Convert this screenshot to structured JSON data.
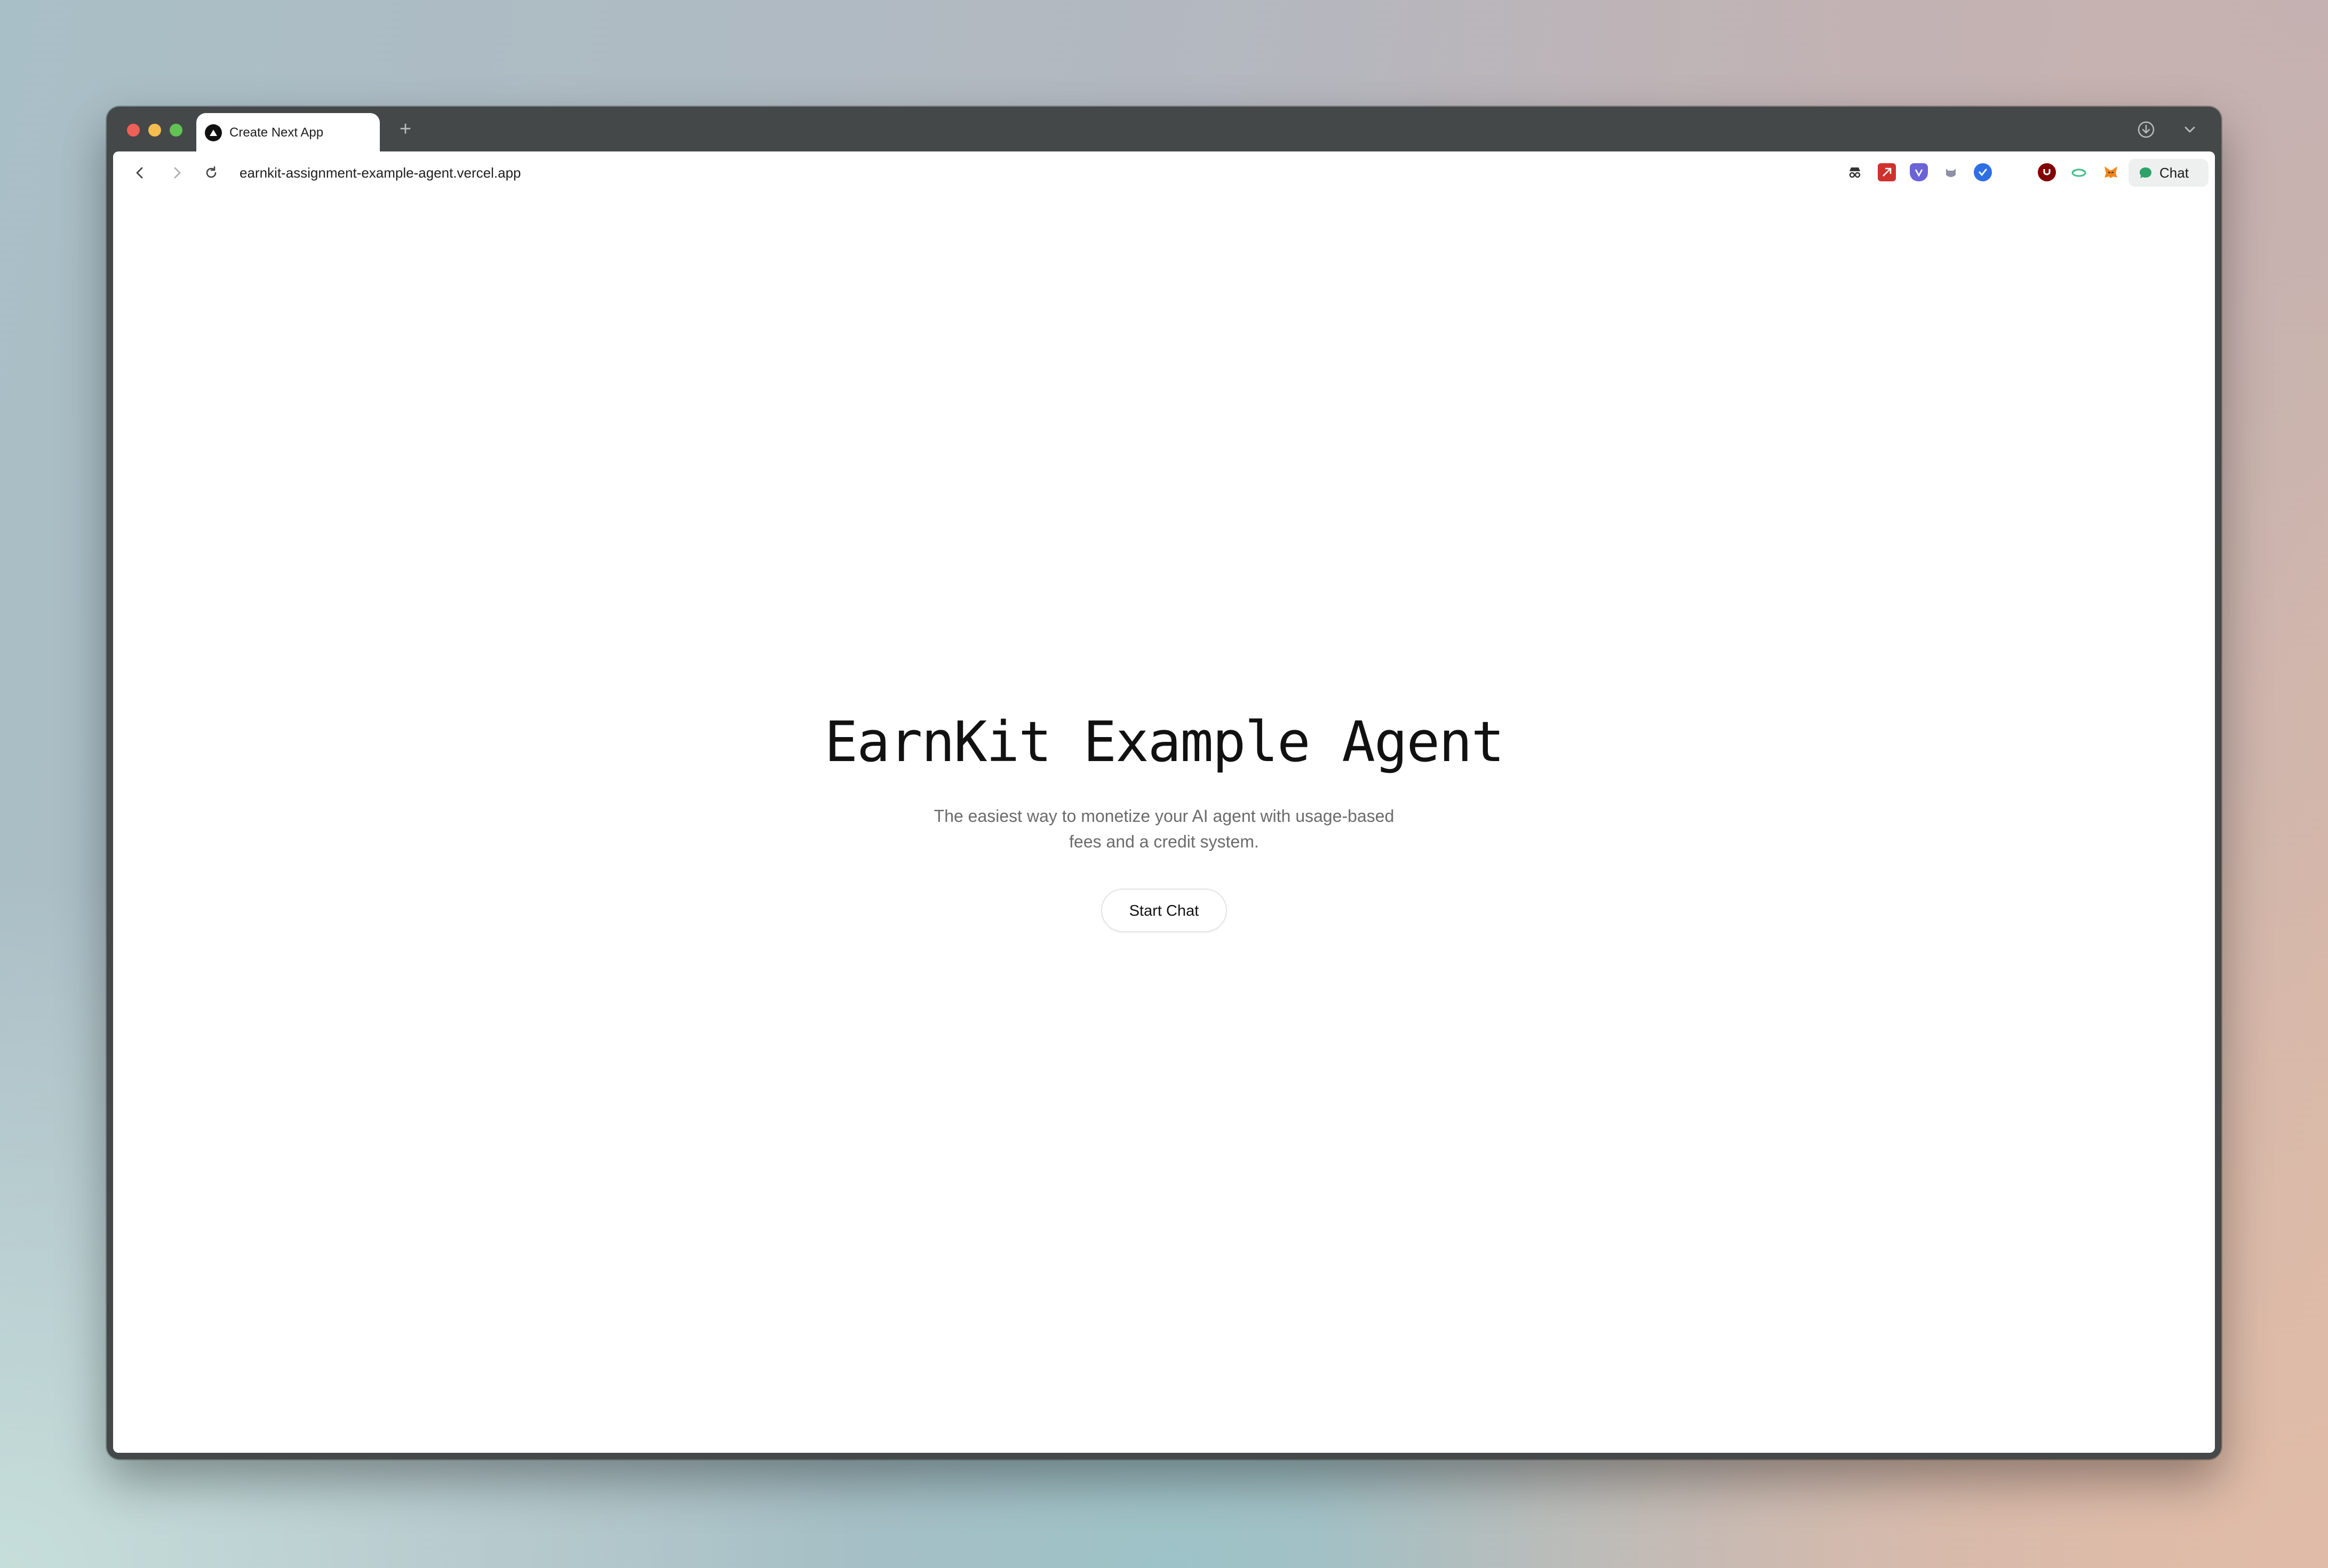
{
  "browser": {
    "tab_title": "Create Next App",
    "new_tab_symbol": "+",
    "url": "earnkit-assignment-example-agent.vercel.app",
    "chat_label": "Chat",
    "extensions": [
      {
        "name": "incognito-extension-icon",
        "color": "#3a3a3a"
      },
      {
        "name": "red-extension-icon",
        "color": "#d0312d"
      },
      {
        "name": "shield-extension-icon",
        "color": "#6b63d6"
      },
      {
        "name": "cat-extension-icon",
        "color": "#8f8fa6"
      },
      {
        "name": "check-extension-icon",
        "color": "#2f6fe4"
      },
      {
        "name": "ublock-extension-icon",
        "color": "#800000"
      },
      {
        "name": "cloud-extension-icon",
        "color": "#3fbf8a"
      },
      {
        "name": "metamask-extension-icon",
        "color": "#f6851b"
      }
    ]
  },
  "page": {
    "title": "EarnKit Example Agent",
    "subtitle": "The easiest way to monetize your AI agent with usage-based fees and a credit system.",
    "cta_label": "Start Chat"
  }
}
